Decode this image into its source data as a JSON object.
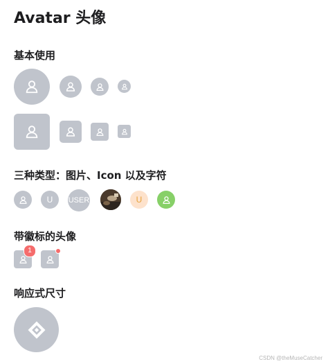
{
  "page": {
    "title": "Avatar 头像",
    "watermark": "CSDN @theMuseCatcher"
  },
  "sections": {
    "basic": "基本使用",
    "types": "三种类型：图片、Icon 以及字符",
    "badge": "带徽标的头像",
    "responsive": "响应式尺寸"
  },
  "type_avatars": {
    "char_u": "U",
    "text_user": "USER",
    "char_u_colored": "U"
  },
  "badges": {
    "count": "1"
  },
  "colors": {
    "avatar_bg": "#c0c4cc",
    "peach_bg": "#fde2cc",
    "peach_text": "#e6a23c",
    "green_bg": "#87d068",
    "badge_red": "#f56c6c"
  },
  "icons": {
    "avatar_default": "user-icon",
    "responsive": "ant-design-icon"
  }
}
